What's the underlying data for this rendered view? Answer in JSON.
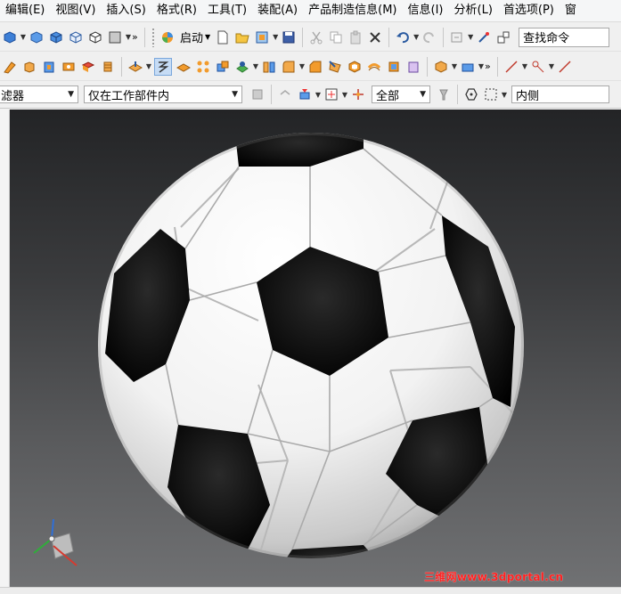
{
  "menubar": {
    "items": [
      "编辑(E)",
      "视图(V)",
      "插入(S)",
      "格式(R)",
      "工具(T)",
      "装配(A)",
      "产品制造信息(M)",
      "信息(I)",
      "分析(L)",
      "首选项(P)",
      "窗"
    ]
  },
  "toolbar1": {
    "start_label": "启动",
    "search_placeholder": "查找命令"
  },
  "toolbar3": {
    "filter_label": "滤器",
    "scope_value": "仅在工作部件内",
    "type_value": "全部",
    "side_value": "内侧"
  },
  "viewport": {
    "watermark": "三维网www.3dportal.cn"
  },
  "colors": {
    "viewport_top": "#232426",
    "viewport_bottom": "#707173",
    "ball_white": "#ffffff",
    "ball_black": "#0a0a0a",
    "watermark": "#ff2020"
  }
}
